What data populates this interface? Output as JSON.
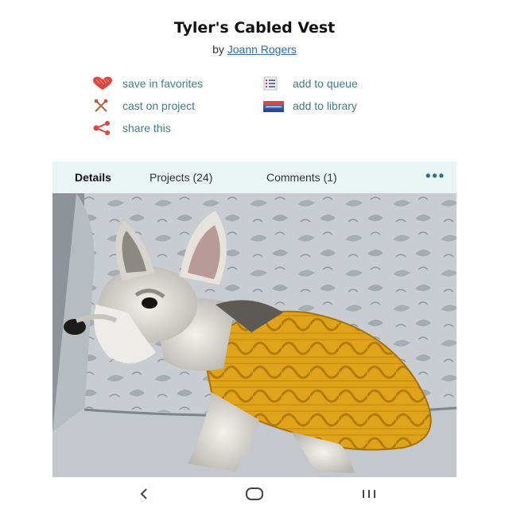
{
  "pattern": {
    "title": "Tyler's Cabled Vest",
    "by_label": "by",
    "author": "Joann Rogers"
  },
  "actions": {
    "favorites": {
      "label": "save in favorites",
      "icon": "heart-icon"
    },
    "queue": {
      "label": "add to queue",
      "icon": "list-icon"
    },
    "cast_on": {
      "label": "cast on project",
      "icon": "needles-icon"
    },
    "library": {
      "label": "add to library",
      "icon": "books-icon"
    },
    "share": {
      "label": "share this",
      "icon": "share-icon"
    }
  },
  "tabs": [
    {
      "label": "Details",
      "active": true
    },
    {
      "label": "Projects (24)",
      "active": false
    },
    {
      "label": "Comments (1)",
      "active": false
    }
  ],
  "more_label": "•••",
  "photo": {
    "description_icon": "dog-in-sweater-photo"
  },
  "colors": {
    "accent": "#3f7c8c",
    "link": "#2a6fa0",
    "heart": "#d9473f",
    "tab_bar": "#e9f5f4",
    "sweater": "#e0a31a"
  },
  "navbar": {
    "back_icon": "back-chevron-icon",
    "home_icon": "home-icon",
    "recents_icon": "recents-icon"
  }
}
